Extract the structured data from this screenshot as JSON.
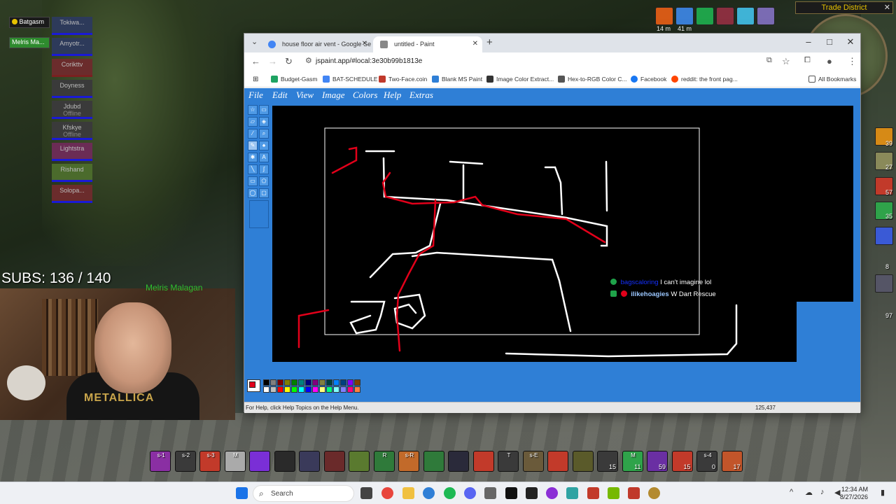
{
  "game": {
    "raid_frames": [
      {
        "name": "Batgasm",
        "color": "#c9a227"
      },
      {
        "name": "Melris Ma...",
        "color": "#2e8b2e"
      }
    ],
    "party_frames": [
      {
        "name": "Tokiwa...",
        "status": ""
      },
      {
        "name": "Amyotr...",
        "status": ""
      },
      {
        "name": "Corikttv",
        "status": ""
      },
      {
        "name": "Doyness",
        "status": ""
      },
      {
        "name": "Jdubd",
        "status": "Offline"
      },
      {
        "name": "Kfskye",
        "status": "Offline"
      },
      {
        "name": "Lightstra",
        "status": ""
      },
      {
        "name": "Rishand",
        "status": ""
      },
      {
        "name": "Solopa...",
        "status": ""
      }
    ],
    "subs_text": "SUBS: 136 / 140",
    "target_name": "Melris Malagan",
    "webcam_shirt_text": "METALLICA",
    "zone": "Trade District",
    "buff_timers": [
      "14 m",
      "41 m"
    ],
    "right_bar_numbers": [
      "39",
      "27",
      "57",
      "35",
      "8",
      "97"
    ],
    "action_bar": [
      {
        "label": "s-1",
        "count": ""
      },
      {
        "label": "s-2",
        "count": ""
      },
      {
        "label": "s-3",
        "count": ""
      },
      {
        "label": "M",
        "count": ""
      },
      {
        "label": "",
        "count": ""
      },
      {
        "label": "",
        "count": ""
      },
      {
        "label": "",
        "count": ""
      },
      {
        "label": "",
        "count": ""
      },
      {
        "label": "",
        "count": ""
      },
      {
        "label": "R",
        "count": ""
      },
      {
        "label": "s-R",
        "count": ""
      },
      {
        "label": "",
        "count": ""
      },
      {
        "label": "",
        "count": ""
      },
      {
        "label": "",
        "count": ""
      },
      {
        "label": "T",
        "count": ""
      },
      {
        "label": "s-E",
        "count": ""
      },
      {
        "label": "",
        "count": ""
      },
      {
        "label": "",
        "count": ""
      },
      {
        "label": "",
        "count": "15"
      },
      {
        "label": "M",
        "count": "11"
      },
      {
        "label": "",
        "count": "59"
      },
      {
        "label": "",
        "count": "15"
      },
      {
        "label": "s-4",
        "count": "0"
      },
      {
        "label": "",
        "count": "17"
      }
    ]
  },
  "browser": {
    "tabs": [
      {
        "title": "house floor air vent - Google Se",
        "active": false,
        "favicon_color": "#4285f4"
      },
      {
        "title": "untitled - Paint",
        "active": true,
        "favicon_color": "#555555"
      }
    ],
    "url": "jspaint.app/#local:3e30b99b1813e",
    "bookmarks": [
      {
        "label": "Budget-Gasm",
        "color": "#1ea362"
      },
      {
        "label": "BAT-SCHEDULE",
        "color": "#4285f4"
      },
      {
        "label": "Two-Face.coin",
        "color": "#c0392b"
      },
      {
        "label": "Blank MS Paint",
        "color": "#2f7fd6"
      },
      {
        "label": "Image Color Extract...",
        "color": "#333333"
      },
      {
        "label": "Hex-to-RGB Color C...",
        "color": "#555555"
      },
      {
        "label": "Facebook",
        "color": "#1877f2"
      },
      {
        "label": "reddit: the front pag...",
        "color": "#ff4500"
      }
    ],
    "all_bookmarks": "All Bookmarks"
  },
  "paint": {
    "menu": [
      "File",
      "Edit",
      "View",
      "Image",
      "Colors",
      "Help",
      "Extras"
    ],
    "status_help": "For Help, click Help Topics on the Help Menu.",
    "status_coords": "125,437",
    "palette": [
      "#000000",
      "#808080",
      "#800000",
      "#808000",
      "#008000",
      "#008080",
      "#000080",
      "#800080",
      "#808040",
      "#004040",
      "#0080ff",
      "#004080",
      "#8000ff",
      "#804000",
      "#ffffff",
      "#c0c0c0",
      "#ff0000",
      "#ffff00",
      "#00ff00",
      "#00ffff",
      "#0000ff",
      "#ff00ff",
      "#ffff80",
      "#00ff80",
      "#80ffff",
      "#8080ff",
      "#ff0080",
      "#ff8040"
    ]
  },
  "chat": [
    {
      "user": "bagscaloring",
      "message": "I can't imagine lol"
    },
    {
      "user": "ilikehoagies",
      "message": "W Dart Rescue"
    }
  ],
  "taskbar": {
    "search_placeholder": "Search",
    "time": "12:34 AM",
    "date": "8/27/2026"
  }
}
